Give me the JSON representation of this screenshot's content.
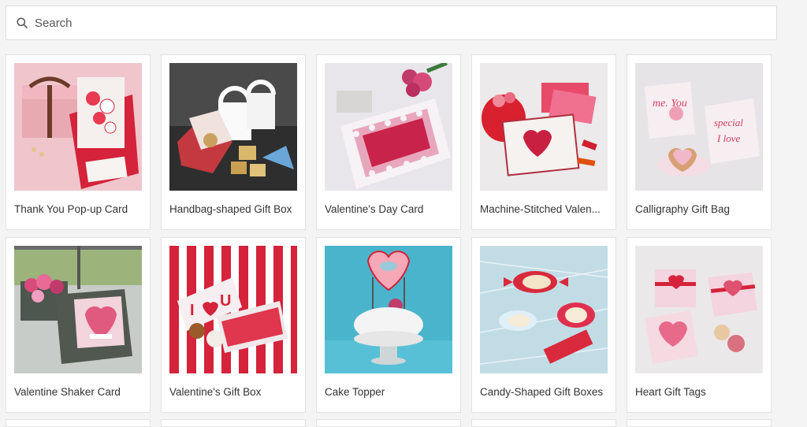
{
  "search": {
    "placeholder": "Search",
    "icon": "search-icon"
  },
  "cards": [
    {
      "title": "Thank You Pop-up Card"
    },
    {
      "title": "Handbag-shaped Gift Box"
    },
    {
      "title": "Valentine's Day Card"
    },
    {
      "title": "Machine-Stitched Valen..."
    },
    {
      "title": "Calligraphy Gift Bag"
    },
    {
      "title": "Valentine Shaker Card"
    },
    {
      "title": "Valentine's Gift Box"
    },
    {
      "title": "Cake Topper"
    },
    {
      "title": "Candy-Shaped Gift Boxes"
    },
    {
      "title": "Heart Gift Tags"
    }
  ],
  "colors": {
    "accent": "#d4233a",
    "border": "#e2e2e2",
    "background": "#f4f4f4"
  }
}
